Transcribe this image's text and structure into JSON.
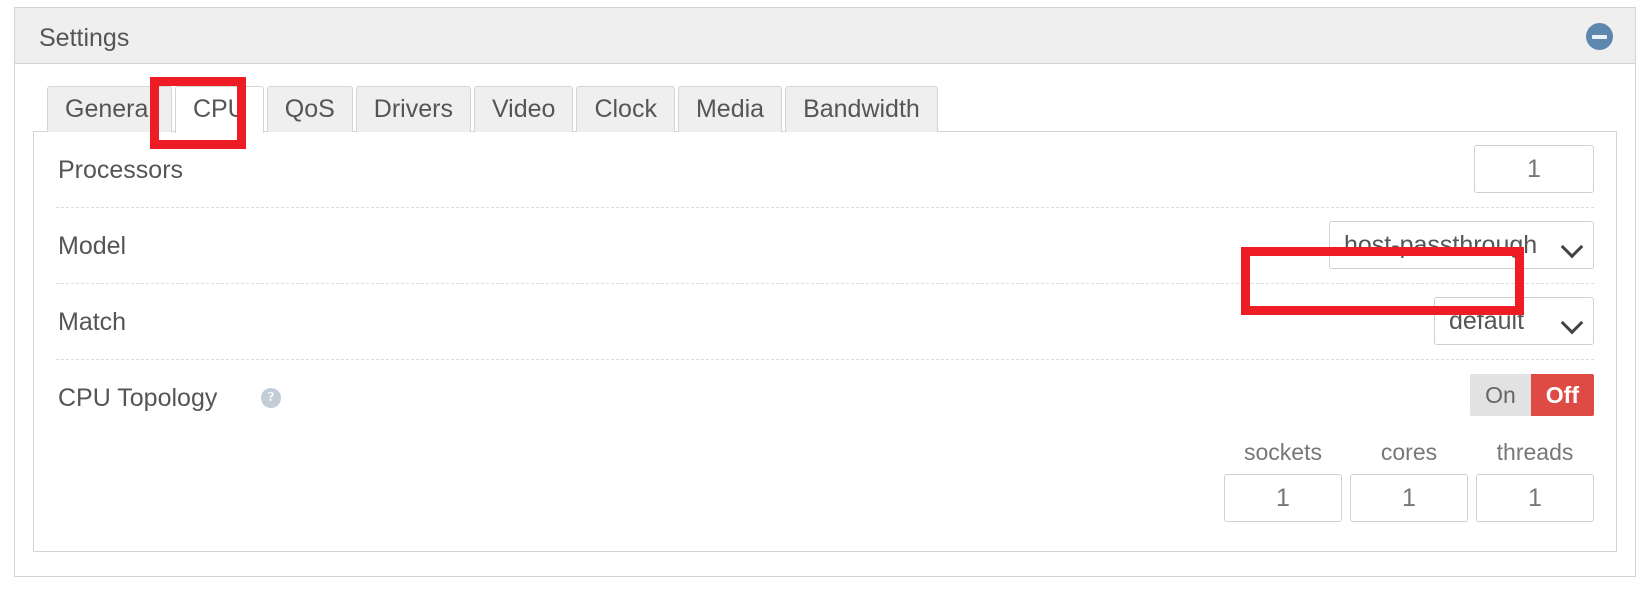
{
  "panel": {
    "title": "Settings",
    "collapse_icon": "minus-circle-icon"
  },
  "tabs": [
    {
      "label": "General",
      "active": false
    },
    {
      "label": "CPU",
      "active": true
    },
    {
      "label": "QoS",
      "active": false
    },
    {
      "label": "Drivers",
      "active": false
    },
    {
      "label": "Video",
      "active": false
    },
    {
      "label": "Clock",
      "active": false
    },
    {
      "label": "Media",
      "active": false
    },
    {
      "label": "Bandwidth",
      "active": false
    }
  ],
  "cpu_form": {
    "processors": {
      "label": "Processors",
      "value": "1"
    },
    "model": {
      "label": "Model",
      "value": "host-passthrough"
    },
    "match": {
      "label": "Match",
      "value": "default"
    },
    "cpu_topology": {
      "label": "CPU Topology",
      "help_icon": "question-mark-icon",
      "help_glyph": "?",
      "toggle": {
        "on_label": "On",
        "off_label": "Off",
        "selected": "Off"
      },
      "columns": [
        {
          "header": "sockets",
          "value": "1"
        },
        {
          "header": "cores",
          "value": "1"
        },
        {
          "header": "threads",
          "value": "1"
        }
      ]
    }
  },
  "annotations": {
    "highlight_color": "#ee1c25",
    "targets": [
      "tab-cpu",
      "model-select"
    ]
  },
  "colors": {
    "accent_red": "#dd4b44",
    "panel_header_bg": "#efefef",
    "collapse_blue": "#5e87b0",
    "border": "#d4d4d4"
  }
}
